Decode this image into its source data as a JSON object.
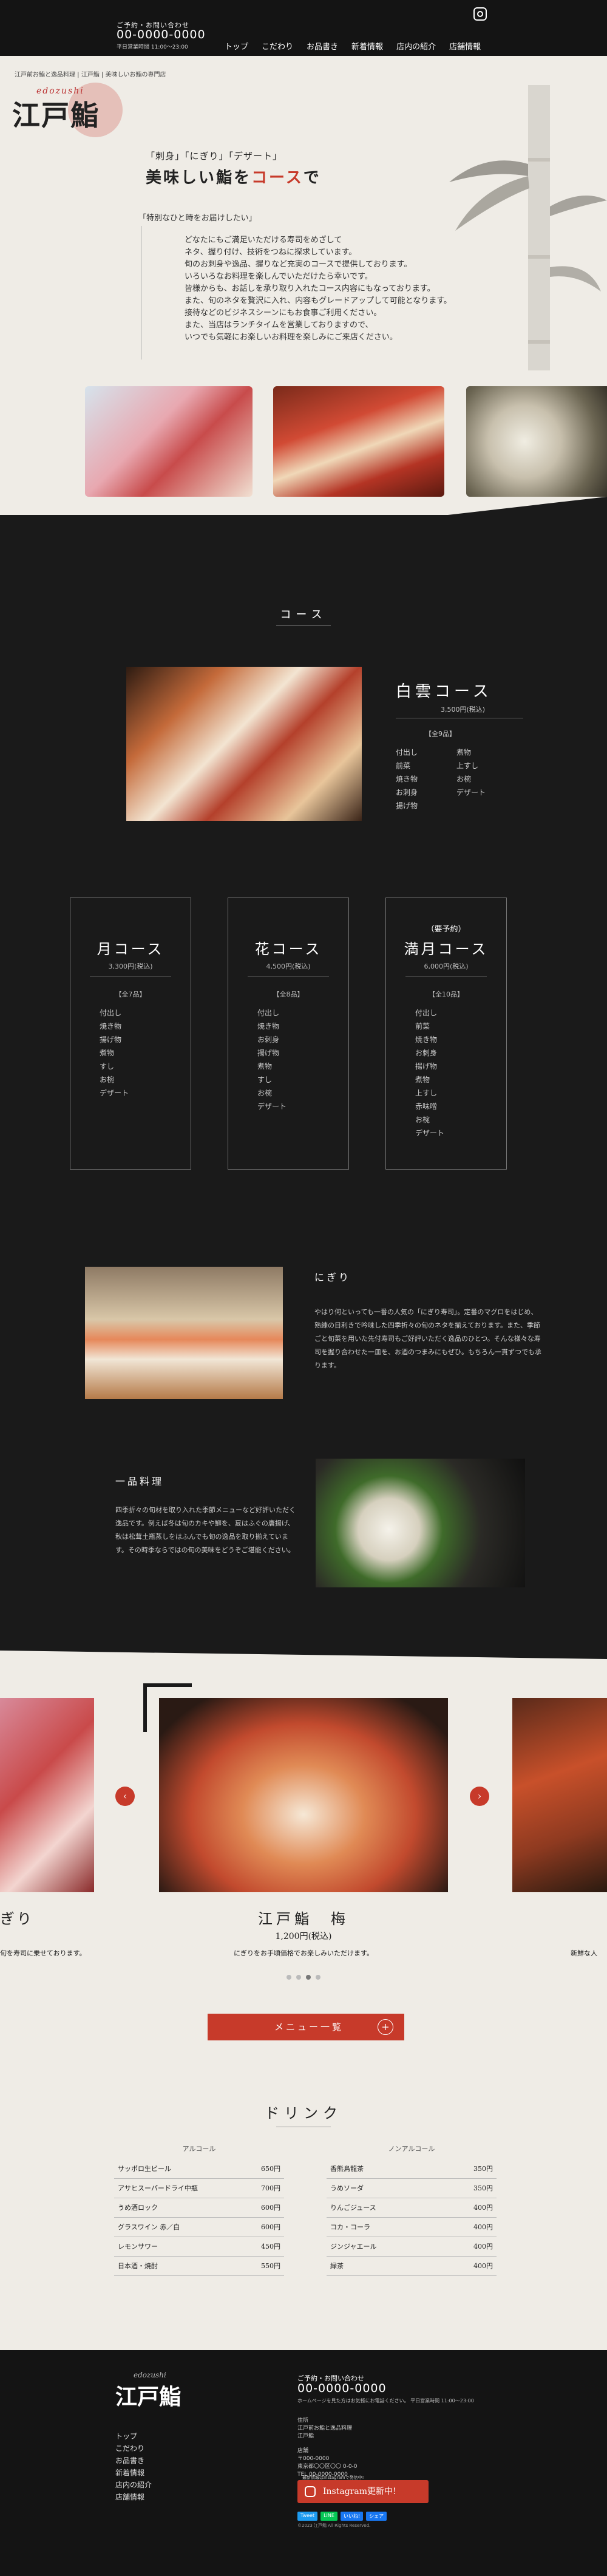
{
  "header": {
    "tel_label": "ご予約・お問い合わせ",
    "tel": "00-0000-0000",
    "hours": "平日営業時間 11:00～23:00",
    "nav": [
      "トップ",
      "こだわり",
      "お品書き",
      "新着情報",
      "店内の紹介",
      "店舗情報"
    ]
  },
  "intro": {
    "address_line": "江戸前お鮨と逸品料理 |  江戸鮨  |  美味しいお鮨の専門店",
    "logo_romaji": "edozushi",
    "logo_kanji": "江戸鮨",
    "subtitle": "「刺身」「にぎり」「デザート」",
    "title_pre": "美味しい鮨を",
    "title_red": "コース",
    "title_post": "で",
    "quote": "「特別なひと時をお届けしたい」",
    "body": [
      "どなたにもご満足いただける寿司をめざして",
      "ネタ、握り付け、技術をつねに探求しています。",
      "旬のお刺身や逸品、握りなど充実のコースで提供しております。",
      "いろいろなお料理を楽しんでいただけたら幸いです。",
      "皆様からも、お話しを承り取り入れたコース内容にもなっております。",
      "また、旬のネタを贅沢に入れ、内容もグレードアップして可能となります。",
      "接待などのビジネスシーンにもお食事ご利用ください。",
      "また、当店はランチタイムを営業しておりますので、",
      "いつでも気軽にお楽しいお料理を楽しみにご来店ください。"
    ]
  },
  "courses": {
    "heading": "コース",
    "hakuun": {
      "title": "白雲コース",
      "price": "3,500円(税込)",
      "count": "【全9品】",
      "items": [
        "付出し",
        "煮物",
        "前菜",
        "上すし",
        "焼き物",
        "お椀",
        "お刺身",
        "デザート",
        "揚げ物"
      ]
    },
    "cards": [
      {
        "pre": "",
        "name": "月コース",
        "price": "3,300円(税込)",
        "count": "【全7品】",
        "items": [
          "付出し",
          "焼き物",
          "揚げ物",
          "煮物",
          "すし",
          "お椀",
          "デザート"
        ]
      },
      {
        "pre": "",
        "name": "花コース",
        "price": "4,500円(税込)",
        "count": "【全8品】",
        "items": [
          "付出し",
          "焼き物",
          "お刺身",
          "揚げ物",
          "煮物",
          "すし",
          "お椀",
          "デザート"
        ]
      },
      {
        "pre": "（要予約）",
        "name": "満月コース",
        "price": "6,000円(税込)",
        "count": "【全10品】",
        "items": [
          "付出し",
          "前菜",
          "焼き物",
          "お刺身",
          "揚げ物",
          "煮物",
          "上すし",
          "赤味噌",
          "お椀",
          "デザート"
        ]
      }
    ]
  },
  "nigiri": {
    "title": "にぎり",
    "body": "やはり何といっても一番の人気の「にぎり寿司」。定番のマグロをはじめ、熟練の目利きで吟味した四季折々の旬のネタを揃えております。また、季節ごと旬菜を用いた先付寿司もご好評いただく逸品のひとつ。そんな様々な寿司を握り合わせた一皿を、お酒のつまみにもぜひ。もちろん一貫ずつでも承ります。"
  },
  "ippin": {
    "title": "一品料理",
    "body": "四季折々の旬材を取り入れた季節メニューなど好評いただく逸品です。例えば冬は旬のカキや鰤を、夏はふぐの唐揚げ、秋は松茸土瓶蒸しをはふんでも旬の逸品を取り揃えています。その時季ならではの旬の美味をどうぞご堪能ください。"
  },
  "carousel": {
    "prev": "‹",
    "next": "›",
    "left_title": "ぎり",
    "left_desc": "旬を寿司に乗せております。",
    "title": "江戸鮨　梅",
    "price": "1,200円(税込)",
    "desc": "にぎりをお手頃価格でお楽しみいただけます。",
    "right_desc": "新鮮な人"
  },
  "menu_button": "メニュー一覧",
  "menu_button_plus": "+",
  "drinks": {
    "heading": "ドリンク",
    "alcohol_label": "アルコール",
    "nonalcohol_label": "ノンアルコール",
    "alcohol": [
      {
        "name": "サッポロ生ビール",
        "price": "650円"
      },
      {
        "name": "アサヒスーパードライ中瓶",
        "price": "700円"
      },
      {
        "name": "うめ酒ロック",
        "price": "600円"
      },
      {
        "name": "グラスワイン 赤／白",
        "price": "600円"
      },
      {
        "name": "レモンサワー",
        "price": "450円"
      },
      {
        "name": "日本酒・焼酎",
        "price": "550円"
      }
    ],
    "nonalcohol": [
      {
        "name": "香熊烏龍茶",
        "price": "350円"
      },
      {
        "name": "うめソーダ",
        "price": "350円"
      },
      {
        "name": "りんごジュース",
        "price": "400円"
      },
      {
        "name": "コカ・コーラ",
        "price": "400円"
      },
      {
        "name": "ジンジャエール",
        "price": "400円"
      },
      {
        "name": "緑茶",
        "price": "400円"
      }
    ]
  },
  "footer": {
    "logo_romaji": "edozushi",
    "logo_kanji": "江戸鮨",
    "nav": [
      "トップ",
      "こだわり",
      "お品書き",
      "新着情報",
      "店内の紹介",
      "店舗情報"
    ],
    "tel_label": "ご予約・お問い合わせ",
    "tel": "00-0000-0000",
    "hours": "ホームページを見た方はお気軽にお電話ください。 平日営業時間 11:00～23:00",
    "addr": [
      "住所",
      "江戸前お鮨と逸品料理",
      "江戸鮨"
    ],
    "shop": [
      "店舗",
      "〒000-0000",
      "東京都〇〇区〇〇 0-0-0",
      "TEL 00-0000-0000"
    ],
    "insta_caption": "最新情報はInstagramで発信中!",
    "insta_btn": "Instagram更新中!",
    "share": [
      "Tweet",
      "LINE",
      "いいね!",
      "シェア"
    ],
    "copyright": "©2023 江戸鮨 All Rights Reserved."
  },
  "colors": {
    "accent": "#c73a2a",
    "dark": "#1a1a1a",
    "paper": "#efece6"
  },
  "icons": [
    "instagram-icon",
    "plus-icon",
    "chevron-left-icon",
    "chevron-right-icon"
  ]
}
